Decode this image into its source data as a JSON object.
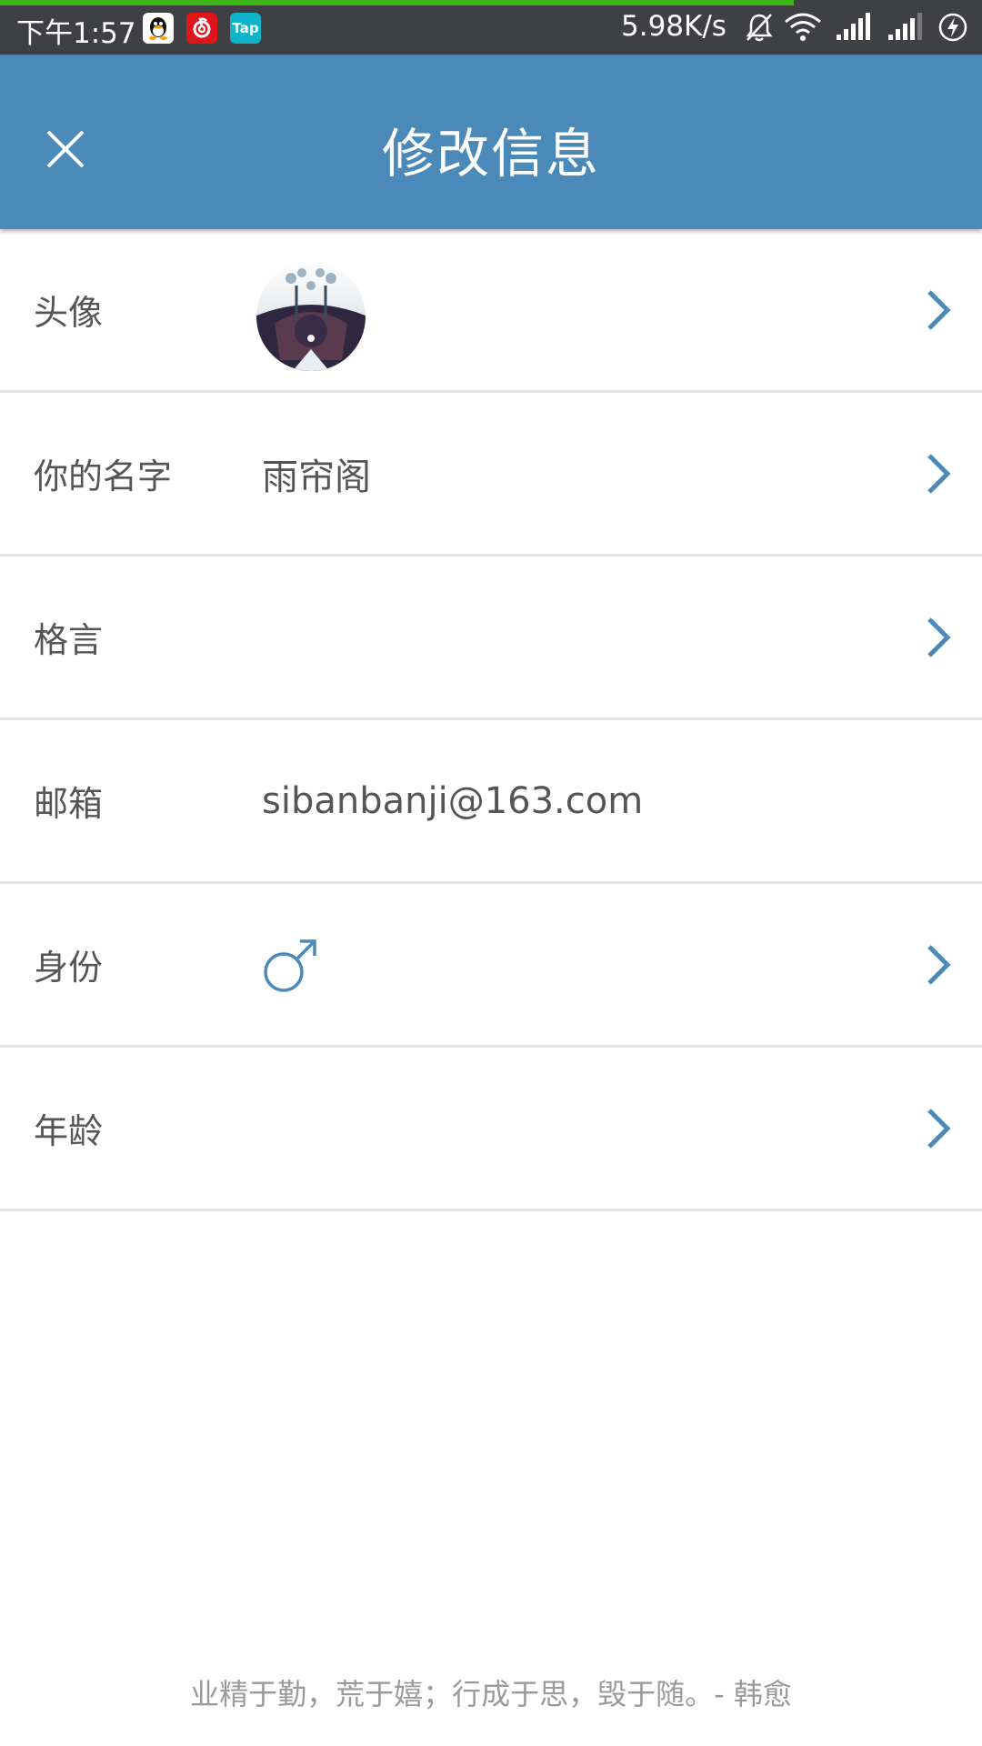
{
  "status_bar": {
    "time": "下午1:57",
    "app_icons": [
      "qq-icon",
      "netease-music-icon",
      "taptap-icon"
    ],
    "tap_label": "Tap",
    "net_speed": "5.98K/s",
    "right_icons": [
      "mute-bell-icon",
      "wifi-icon",
      "signal-icon",
      "signal-icon",
      "charging-battery-icon"
    ],
    "progress_color": "#3fb718"
  },
  "app_bar": {
    "title": "修改信息",
    "close_icon": "close-icon",
    "color": "#4a89b8"
  },
  "rows": [
    {
      "label": "头像",
      "value": "",
      "type": "avatar",
      "chevron": true
    },
    {
      "label": "你的名字",
      "value": "雨帘阁",
      "type": "text",
      "chevron": true
    },
    {
      "label": "格言",
      "value": "",
      "type": "text",
      "chevron": true
    },
    {
      "label": "邮箱",
      "value": "sibanbanji@163.com",
      "type": "text",
      "chevron": false
    },
    {
      "label": "身份",
      "value": "",
      "type": "gender",
      "gender_icon": "male-symbol-icon",
      "chevron": true
    },
    {
      "label": "年龄",
      "value": "",
      "type": "text",
      "chevron": true
    }
  ],
  "footer": {
    "quote": "业精于勤，荒于嬉；行成于思，毁于随。- 韩愈"
  },
  "accent_color": "#4a89b8"
}
